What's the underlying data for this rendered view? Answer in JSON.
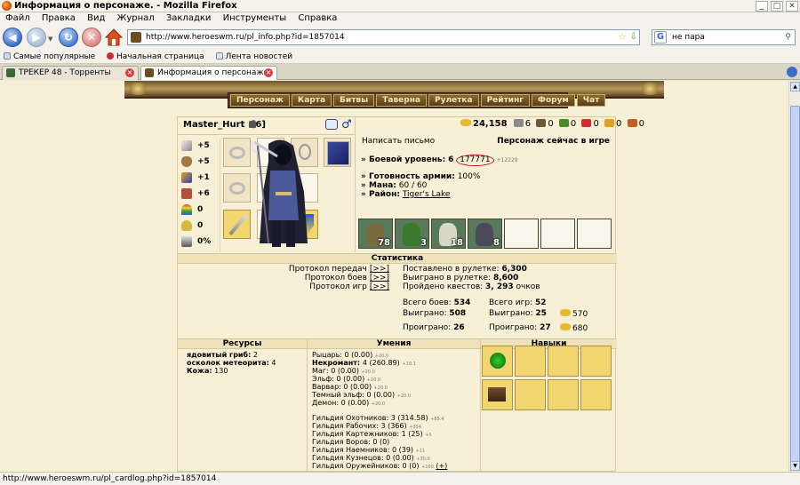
{
  "window": {
    "title": "Информация о персонаже. - Mozilla Firefox",
    "controls": [
      "_",
      "□",
      "✕"
    ]
  },
  "menu": [
    "Файл",
    "Правка",
    "Вид",
    "Журнал",
    "Закладки",
    "Инструменты",
    "Справка"
  ],
  "address": {
    "url": "http://www.heroeswm.ru/pl_info.php?id=1857014"
  },
  "search": {
    "value": "не пара",
    "engine_letter": "G"
  },
  "bookmarks": [
    "Самые популярные",
    "Начальная страница",
    "Лента новостей"
  ],
  "tabs": [
    {
      "label": "ТРЕКЕР 48 - Торренты",
      "active": false
    },
    {
      "label": "Информация о персонаже.",
      "active": true
    }
  ],
  "site_nav": [
    "Персонаж",
    "Карта",
    "Битвы",
    "Таверна",
    "Рулетка",
    "Рейтинг",
    "Форум",
    "Чат"
  ],
  "character": {
    "name": "Master_Hurt",
    "level": "[6]",
    "stats": [
      "+5",
      "+5",
      "+1",
      "+6",
      "0",
      "0",
      "0%"
    ],
    "stat_icons": [
      "sword-icon",
      "shield-icon",
      "wand-icon",
      "book-icon",
      "rainbow-icon",
      "horseshoe-icon",
      "flask-icon"
    ]
  },
  "resources": {
    "gold": "24,158",
    "items": [
      "6",
      "0",
      "0",
      "0",
      "0",
      "0"
    ],
    "colors": [
      "#8a8a8a",
      "#6a5a3a",
      "#4a8a2a",
      "#d03030",
      "#e0a020",
      "#c06020"
    ]
  },
  "info": {
    "write_letter": "Написать письмо",
    "online_status": "Персонаж сейчас в игре",
    "combat_level_label": "» Боевой уровень:",
    "combat_level_value": "6",
    "exp": "177771",
    "exp_extra": "+12229",
    "army_ready_label": "» Готовность армии:",
    "army_ready_value": "100%",
    "mana_label": "» Мана:",
    "mana_value": "60 / 60",
    "district_label": "» Район:",
    "district_value": "Tiger's Lake"
  },
  "army": [
    {
      "count": "78",
      "color": "#7a6a40"
    },
    {
      "count": "3",
      "color": "#3a7a2a"
    },
    {
      "count": "18",
      "color": "#d8d8c8"
    },
    {
      "count": "8",
      "color": "#4a4a5a"
    },
    {
      "count": "",
      "color": ""
    },
    {
      "count": "",
      "color": ""
    },
    {
      "count": "",
      "color": ""
    }
  ],
  "statistics": {
    "header": "Статистика",
    "protocols": [
      {
        "label": "Протокол передач",
        "link": "[>>]"
      },
      {
        "label": "Протокол боев",
        "link": "[>>]"
      },
      {
        "label": "Протокол игр",
        "link": "[>>]"
      }
    ],
    "roulette_bet_label": "Поставлено в рулетке:",
    "roulette_bet_value": "6,300",
    "roulette_win_label": "Выиграно в рулетке:",
    "roulette_win_value": "8,600",
    "quests_label": "Пройдено квестов:",
    "quests_value": "3, 293",
    "quests_suffix": "очков",
    "battles_total_label": "Всего боев:",
    "battles_total": "534",
    "battles_won_label": "Выиграно:",
    "battles_won": "508",
    "battles_lost_label": "Проиграно:",
    "battles_lost": "26",
    "games_total_label": "Всего игр:",
    "games_total": "52",
    "games_won_label": "Выиграно:",
    "games_won": "25",
    "games_lost_label": "Проиграно:",
    "games_lost": "27",
    "gold_won": "570",
    "gold_lost": "680"
  },
  "resources_section": {
    "header": "Ресурсы",
    "items": [
      {
        "name": "ядовитый гриб:",
        "value": "2"
      },
      {
        "name": "осколок метеорита:",
        "value": "4"
      },
      {
        "name": "Кожа:",
        "value": "130"
      }
    ]
  },
  "skills": {
    "header": "Умения",
    "factions": [
      {
        "name": "Рыцарь:",
        "value": "0 (0.00)",
        "extra": "+20.0",
        "bold": false
      },
      {
        "name": "Некромант:",
        "value": "4 (260.89)",
        "extra": "+19.1",
        "bold": true
      },
      {
        "name": "Маг:",
        "value": "0 (0.00)",
        "extra": "+20.0",
        "bold": false
      },
      {
        "name": "Эльф:",
        "value": "0 (0.00)",
        "extra": "+20.0",
        "bold": false
      },
      {
        "name": "Варвар:",
        "value": "0 (0.00)",
        "extra": "+20.0",
        "bold": false
      },
      {
        "name": "Темный эльф:",
        "value": "0 (0.00)",
        "extra": "+20.0",
        "bold": false
      },
      {
        "name": "Демон:",
        "value": "0 (0.00)",
        "extra": "+20.0",
        "bold": false
      }
    ],
    "guilds": [
      {
        "name": "Гильдия Охотников:",
        "value": "3 (314.58)",
        "extra": "+85.4"
      },
      {
        "name": "Гильдия Рабочих:",
        "value": "3 (366)",
        "extra": "+354"
      },
      {
        "name": "Гильдия Картежников:",
        "value": "1 (25)",
        "extra": "+5"
      },
      {
        "name": "Гильдия Воров:",
        "value": "0 (0)",
        "extra": ""
      },
      {
        "name": "Гильдия Наемников:",
        "value": "0 (39)",
        "extra": "+11"
      },
      {
        "name": "Гильдия Кузнецов:",
        "value": "0 (0.00)",
        "extra": "+30.0"
      },
      {
        "name": "Гильдия Оружейников:",
        "value": "0 (0)",
        "extra": "+100"
      }
    ],
    "plus": "(+)"
  },
  "navyki": {
    "header": "Навыки"
  },
  "status_bar": "http://www.heroeswm.ru/pl_cardlog.php?id=1857014"
}
